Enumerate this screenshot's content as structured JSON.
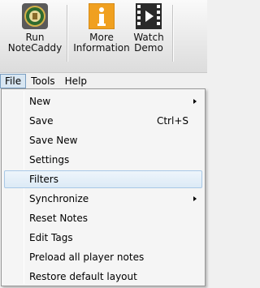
{
  "toolbar": {
    "buttons": [
      {
        "label": "Run\nNoteCaddy",
        "icon": "notecaddy-logo-icon"
      },
      {
        "label": "More\nInformation",
        "icon": "info-icon"
      },
      {
        "label": "Watch\nDemo",
        "icon": "film-play-icon"
      }
    ]
  },
  "menubar": {
    "items": [
      "File",
      "Tools",
      "Help"
    ],
    "active": "File"
  },
  "file_menu": {
    "items": [
      {
        "label": "New",
        "shortcut": "",
        "submenu": true
      },
      {
        "label": "Save",
        "shortcut": "Ctrl+S",
        "submenu": false
      },
      {
        "label": "Save New",
        "shortcut": "",
        "submenu": false
      },
      {
        "label": "Settings",
        "shortcut": "",
        "submenu": false
      },
      {
        "label": "Filters",
        "shortcut": "",
        "submenu": false,
        "highlighted": true
      },
      {
        "label": "Synchronize",
        "shortcut": "",
        "submenu": true
      },
      {
        "label": "Reset Notes",
        "shortcut": "",
        "submenu": false
      },
      {
        "label": "Edit Tags",
        "shortcut": "",
        "submenu": false
      },
      {
        "label": "Preload all player notes",
        "shortcut": "",
        "submenu": false
      },
      {
        "label": "Restore default layout",
        "shortcut": "",
        "submenu": false
      }
    ]
  },
  "colors": {
    "highlight": "#dceaf6",
    "highlight_border": "#a8c8e6",
    "info_orange": "#f0a020",
    "logo_green": "#2f6b2f",
    "logo_gold": "#d4b24a"
  }
}
